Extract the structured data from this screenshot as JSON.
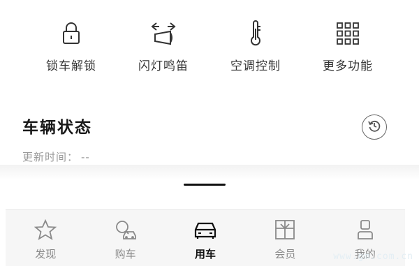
{
  "quick_actions": [
    {
      "label": "锁车解锁",
      "icon": "lock-icon"
    },
    {
      "label": "闪灯鸣笛",
      "icon": "flash-horn-icon"
    },
    {
      "label": "空调控制",
      "icon": "thermometer-icon"
    },
    {
      "label": "更多功能",
      "icon": "grid-icon"
    }
  ],
  "status": {
    "title": "车辆状态",
    "update_label": "更新时间：",
    "update_value": "--",
    "refresh_icon": "refresh-icon"
  },
  "tabbar": {
    "active": "用车",
    "tabs": [
      {
        "label": "发现",
        "icon": "star-icon"
      },
      {
        "label": "购车",
        "icon": "car-buy-icon"
      },
      {
        "label": "用车",
        "icon": "car-front-icon"
      },
      {
        "label": "会员",
        "icon": "gift-icon"
      },
      {
        "label": "我的",
        "icon": "person-icon"
      }
    ]
  },
  "watermark": "www.gm.com.cn",
  "colors": {
    "active_tab": "#111111",
    "inactive_tab": "#8a8a8a",
    "muted_text": "#9a9a9a"
  }
}
